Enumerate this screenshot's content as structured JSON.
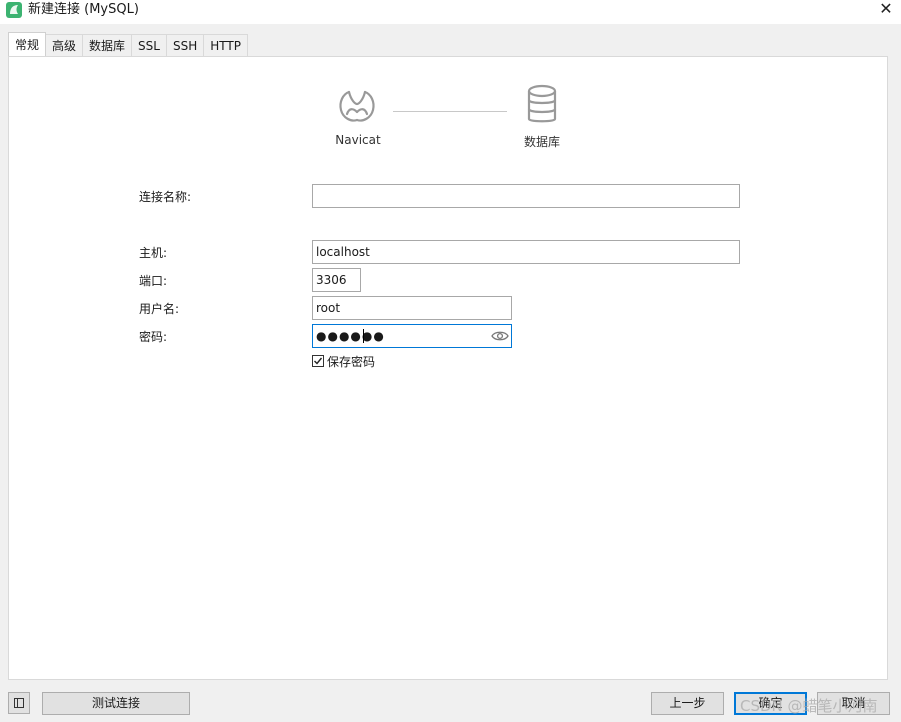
{
  "window": {
    "title": "新建连接 (MySQL)",
    "close_glyph": "✕"
  },
  "tabs": [
    {
      "label": "常规",
      "active": true
    },
    {
      "label": "高级",
      "active": false
    },
    {
      "label": "数据库",
      "active": false
    },
    {
      "label": "SSL",
      "active": false
    },
    {
      "label": "SSH",
      "active": false
    },
    {
      "label": "HTTP",
      "active": false
    }
  ],
  "diagram": {
    "left_label": "Navicat",
    "right_label": "数据库",
    "left_icon": "navicat-logo-icon",
    "right_icon": "database-icon"
  },
  "form": {
    "connection_name": {
      "label": "连接名称:",
      "value": ""
    },
    "host": {
      "label": "主机:",
      "value": "localhost"
    },
    "port": {
      "label": "端口:",
      "value": "3306"
    },
    "username": {
      "label": "用户名:",
      "value": "root"
    },
    "password": {
      "label": "密码:",
      "masked_value": "●●●●●●"
    },
    "save_password": {
      "label": "保存密码",
      "checked": true
    }
  },
  "buttons": {
    "test_connection": "测试连接",
    "back": "上一步",
    "ok": "确定",
    "cancel": "取消"
  },
  "watermark": "CSDN @蜡笔小河南",
  "colors": {
    "focus_border": "#0078d7",
    "panel_bg": "#ffffff",
    "window_bg": "#f0f0f0"
  }
}
